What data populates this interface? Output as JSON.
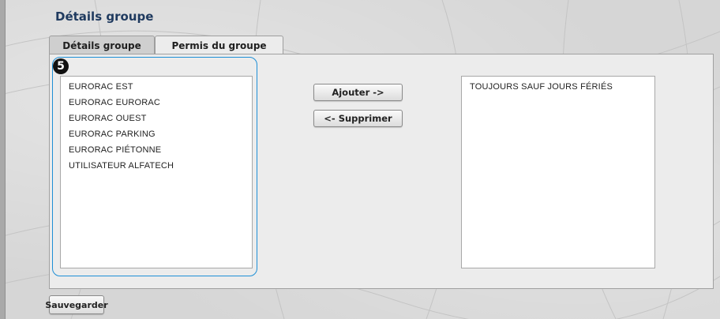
{
  "page": {
    "title": "Détails groupe"
  },
  "tabs": [
    {
      "label": "Détails groupe",
      "active": false
    },
    {
      "label": "Permis du groupe",
      "active": true
    }
  ],
  "step_badge": "5",
  "available_list": {
    "items": [
      "EURORAC EST",
      "EURORAC EURORAC",
      "EURORAC OUEST",
      "EURORAC PARKING",
      "EURORAC PIÉTONNE",
      "UTILISATEUR ALFATECH"
    ]
  },
  "assigned_list": {
    "items": [
      "TOUJOURS SAUF JOURS FÉRIÉS"
    ]
  },
  "actions": {
    "add_label": "Ajouter ->",
    "remove_label": "<- Supprimer",
    "save_label": "Sauvegarder"
  },
  "colors": {
    "title": "#1f3a5f",
    "highlight": "#1e8fd6",
    "panel": "#ececec"
  }
}
